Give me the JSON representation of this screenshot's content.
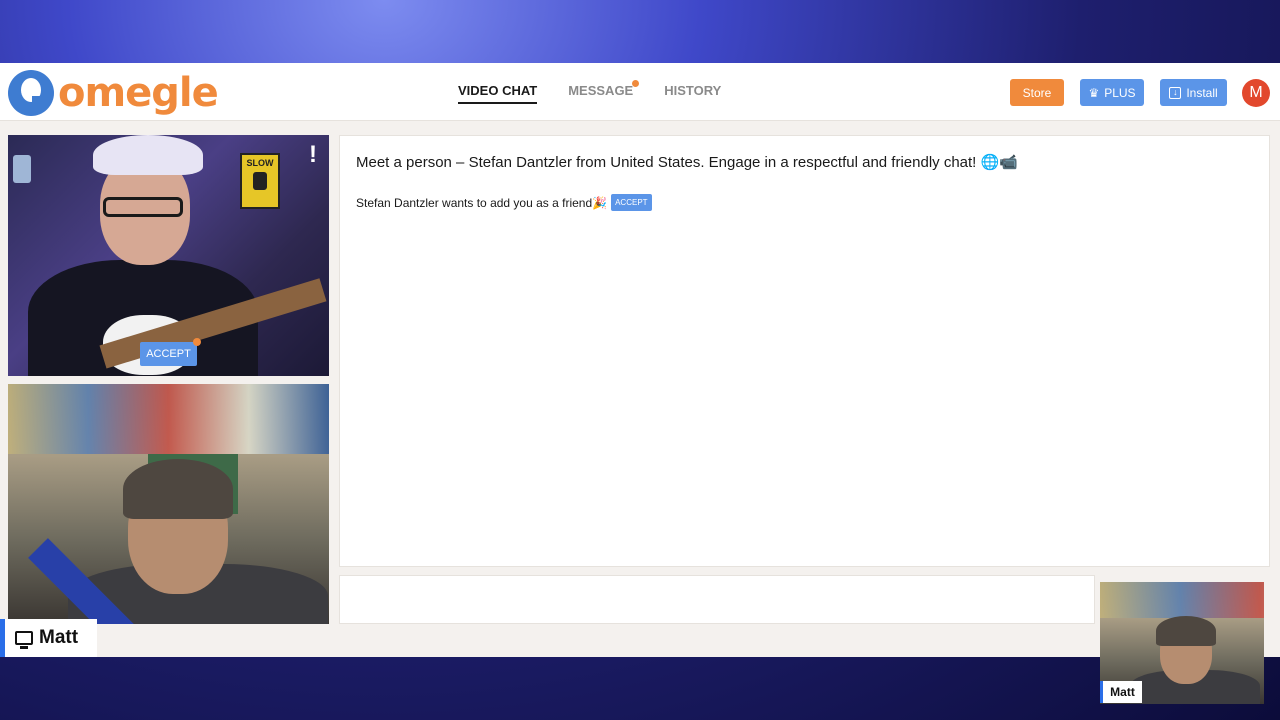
{
  "brand": {
    "logo_text": "omegle"
  },
  "nav": {
    "items": [
      {
        "label": "VIDEO CHAT",
        "active": true,
        "badge": false
      },
      {
        "label": "MESSAGE",
        "active": false,
        "badge": true
      },
      {
        "label": "HISTORY",
        "active": false,
        "badge": false
      }
    ]
  },
  "header_actions": {
    "store_label": "Store",
    "plus_label": "PLUS",
    "install_label": "Install",
    "avatar_initial": "M"
  },
  "remote_video": {
    "sign_text": "SLOW",
    "alert_mark": "!",
    "accept_label": "ACCEPT"
  },
  "chat": {
    "headline": "Meet a person – Stefan Dantzler from United States. Engage in a respectful and friendly chat! 🌐📹",
    "friend_request_text": "Stefan Dantzler wants to add you as a friend🎉",
    "friend_request_button": "ACCEPT"
  },
  "self_video": {
    "name": "Matt"
  },
  "pip": {
    "name": "Matt"
  },
  "colors": {
    "accent_orange": "#f08a3c",
    "accent_blue": "#5b95e8",
    "avatar_red": "#e2482d"
  }
}
